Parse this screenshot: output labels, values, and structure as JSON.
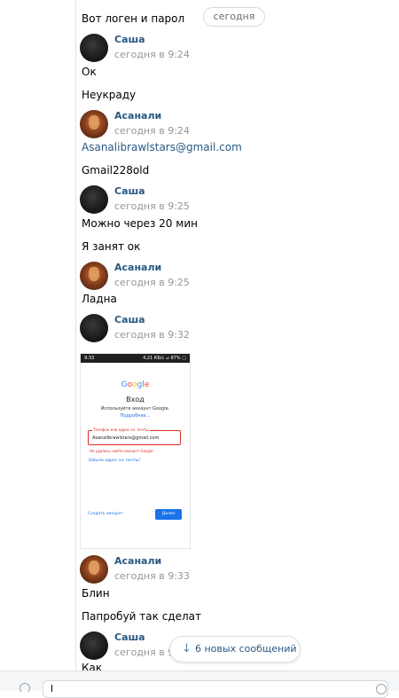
{
  "date_divider": "сегодня",
  "messages": {
    "m0": "Вот логен и парол",
    "g1": {
      "author": "Саша",
      "time": "сегодня в 9:24",
      "lines": [
        "Ок",
        "Неукраду"
      ]
    },
    "g2": {
      "author": "Асанали",
      "time": "сегодня в 9:24",
      "lines": [
        "Asanalibrawlstars@gmail.com",
        "Gmail228old"
      ]
    },
    "g3": {
      "author": "Саша",
      "time": "сегодня в 9:25",
      "lines": [
        "Можно через 20 мин",
        "Я занят ок"
      ]
    },
    "g4": {
      "author": "Асанали",
      "time": "сегодня в 9:25",
      "lines": [
        "Ладна"
      ]
    },
    "g5": {
      "author": "Саша",
      "time": "сегодня в 9:32"
    },
    "g6": {
      "author": "Асанали",
      "time": "сегодня в 9:33",
      "lines": [
        "Блин",
        "Папробуй так сделат"
      ]
    },
    "g7": {
      "author": "Саша",
      "time": "сегодня в 9:",
      "lines": [
        "Как"
      ]
    }
  },
  "attachment": {
    "status_left": "9:33",
    "status_right": "4,21 КБ/с ⊿ 87% ▢",
    "logo": [
      "G",
      "o",
      "o",
      "g",
      "l",
      "e"
    ],
    "title": "Вход",
    "subtitle": "Используйте аккаунт Google.",
    "more": "Подробнее...",
    "field_label": "Телефон или адрес эл. почты",
    "field_value": "Asanalibrawlstars@gmail.com",
    "error": "Не удалось найти аккаунт Google",
    "forgot": "Забыли адрес эл. почты?",
    "create": "Создать аккаунт",
    "next": "Далее"
  },
  "new_messages_label": "6 новых сообщений",
  "colors": {
    "link": "#2a5885",
    "time": "#93969c",
    "accent": "#5181b8"
  }
}
